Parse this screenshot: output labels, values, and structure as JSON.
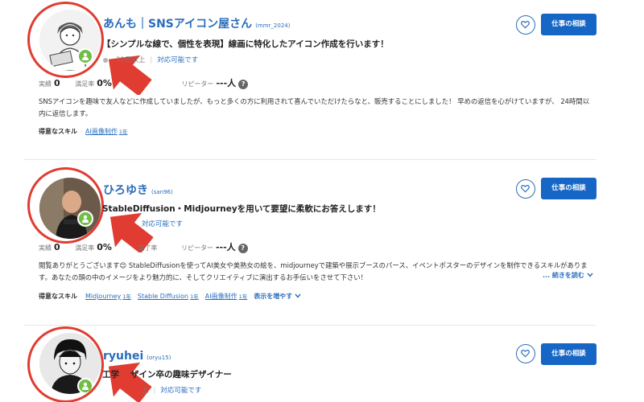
{
  "colors": {
    "brand_blue": "#1666c5",
    "link_blue": "#2a6ebd",
    "online_green": "#6fbe44",
    "annotation_red": "#e03c31"
  },
  "icons": {
    "favorite": "heart-icon",
    "online": "person-icon",
    "help": "question-icon",
    "expand": "chevron-down-icon",
    "annotation": "red-arrow",
    "highlight": "red-circle"
  },
  "labels": {
    "consult_button": "仕事の相談",
    "achievements": "実績",
    "satisfaction": "満足率",
    "repeaters": "リピーター",
    "completion": "完了率",
    "skills": "得意なスキル",
    "help": "?"
  },
  "sellers": [
    {
      "name": "あんも｜SNSアイコン屋さん",
      "handle": "(mmr_2024)",
      "headline": "【シンプルな線で、個性を表現】線画に特化したアイコン作成を行います！",
      "login": "30日以上",
      "availability": "対応可能です",
      "achievements": "0",
      "satisfaction": "0%",
      "repeaters": "---人",
      "description": "SNSアイコンを趣味で友人などに作成していましたが、もっと多くの方に利用されて喜んでいただけたらなと、販売することにしました！ 早めの返信を心がけていますが、 24時間以内に返信します。",
      "skills": [
        {
          "name": "AI画像制作",
          "years": "1年"
        }
      ]
    },
    {
      "name": "ひろゆき",
      "handle": "(san96)",
      "headline": "StableDiffusion・Midjourneyを用いて要望に柔軟にお答えします！",
      "availability": "対応可能です",
      "achievements": "0",
      "satisfaction": "0%",
      "completion_fragment": "完了率",
      "repeaters": "---人",
      "description": "閲覧ありがとうございます😊 StableDiffusionを使ってAI美女や美熟女の絵を、midjourneyで建築や展示ブースのパース、イベントポスターのデザインを制作できるスキルがあります。あなたの頭の中のイメージをより魅力的に、そしてクリエイティブに演出するお手伝いをさせて下さい！",
      "read_more": "... 続きを読む",
      "skills": [
        {
          "name": "Midjourney",
          "years": "1年"
        },
        {
          "name": "Stable Diffusion",
          "years": "1年"
        },
        {
          "name": "AI画像制作",
          "years": "1年"
        }
      ],
      "show_more": "表示を増やす"
    },
    {
      "name": "ryuhei",
      "handle": "(oryu15)",
      "headline_fragment_1": "工学",
      "headline_fragment_2": "ザイン卒の趣味デザイナー",
      "login_fragment": "上",
      "availability": "対応可能です"
    }
  ]
}
